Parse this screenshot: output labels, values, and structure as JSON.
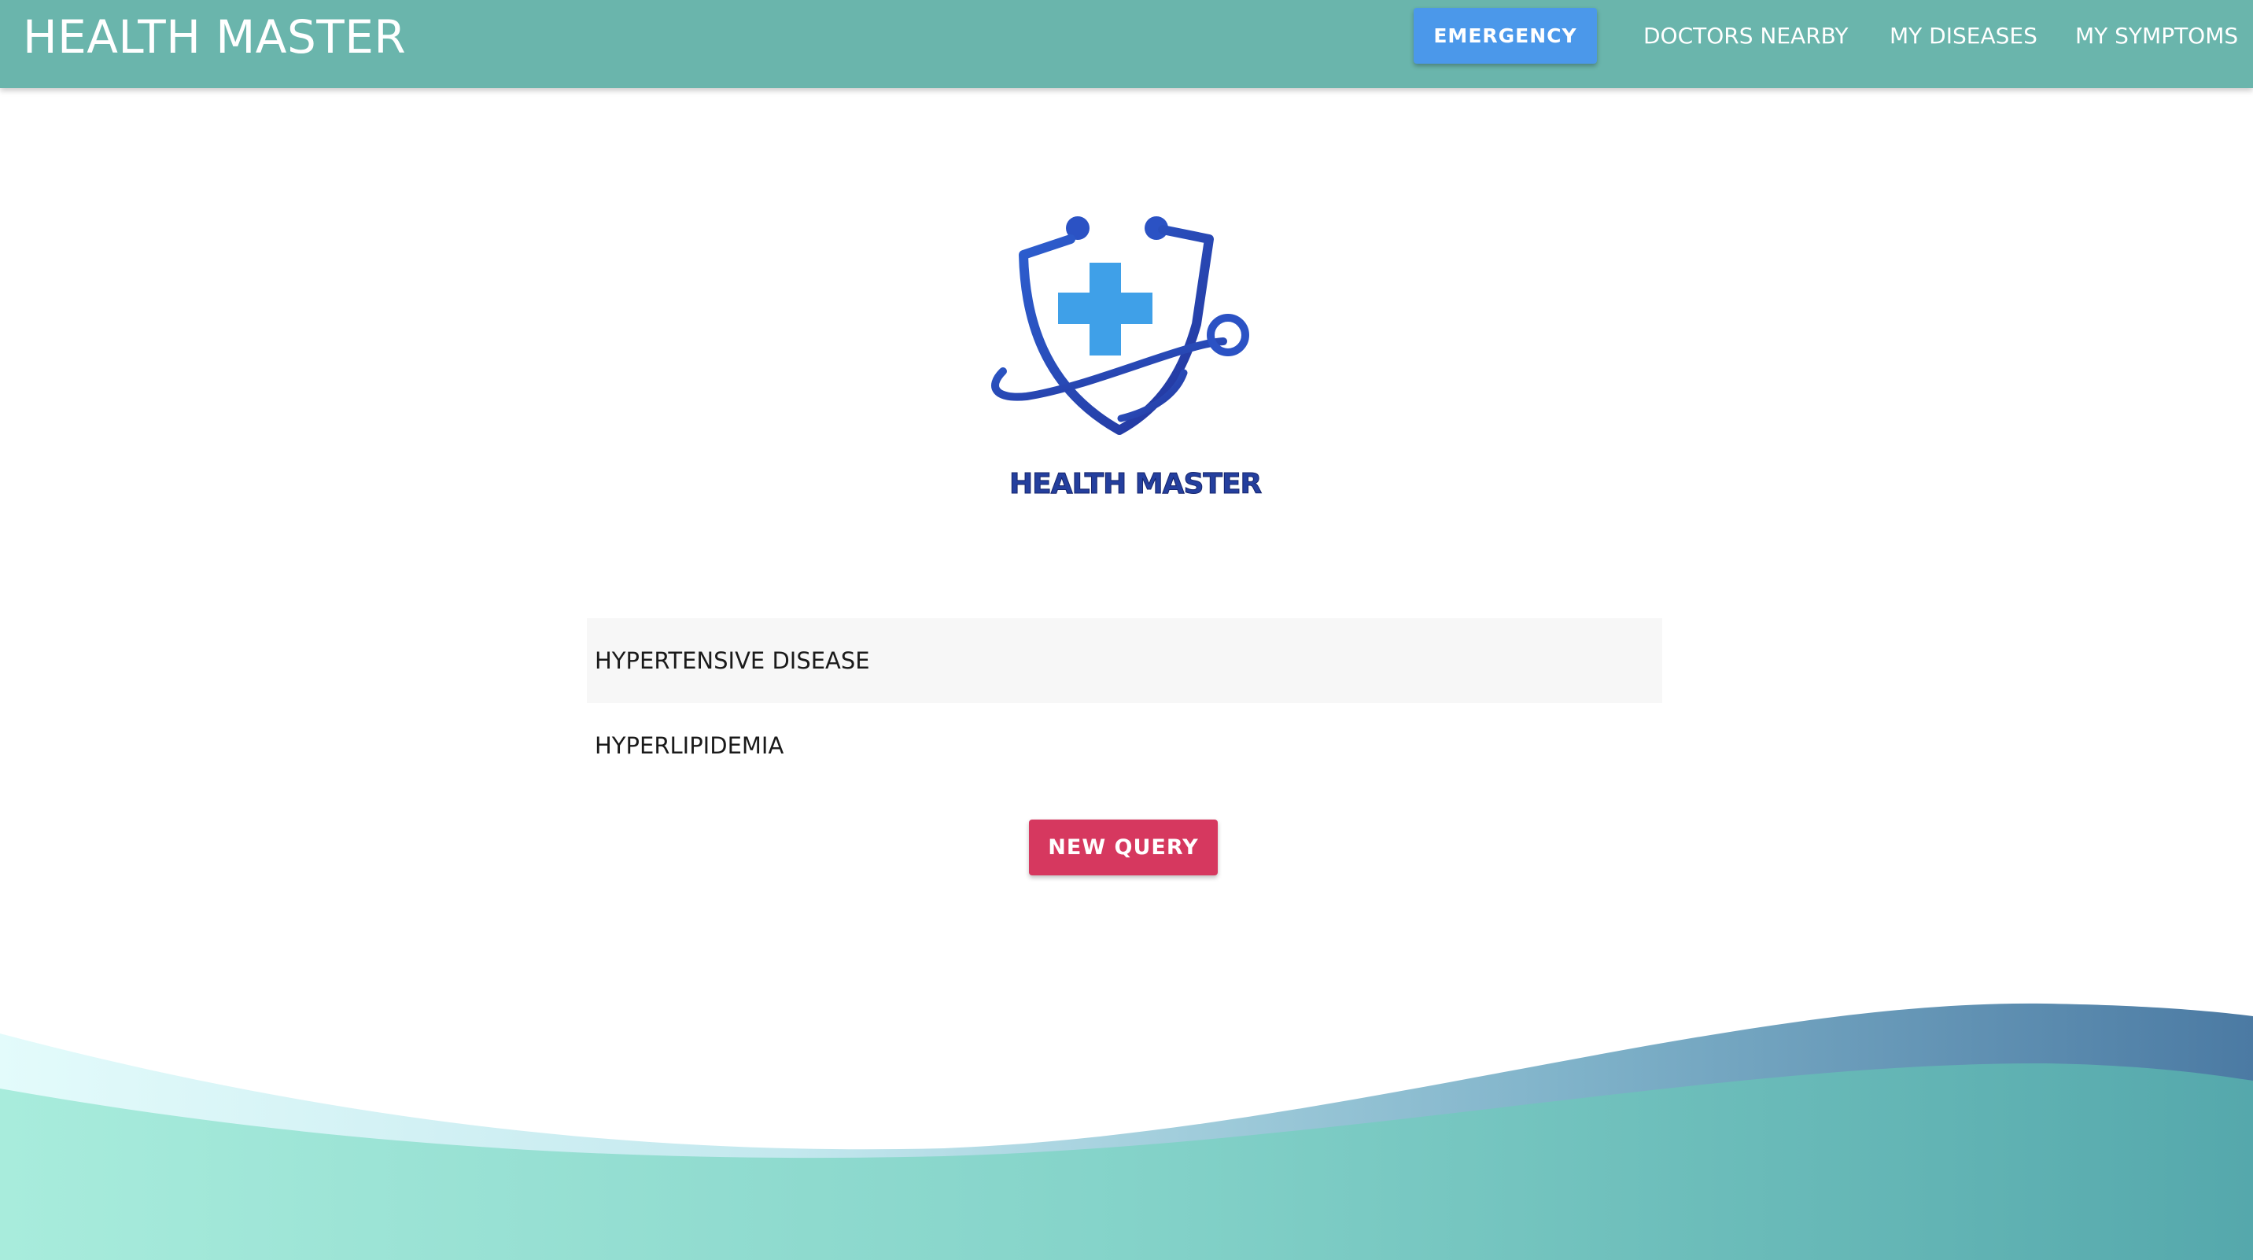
{
  "navbar": {
    "brand": "HEALTH MASTER",
    "emergency_label": "EMERGENCY",
    "links": [
      {
        "label": "DOCTORS NEARBY"
      },
      {
        "label": "MY DISEASES"
      },
      {
        "label": "MY SYMPTOMS"
      }
    ]
  },
  "logo": {
    "text": "HEALTH MASTER",
    "icon": "shield-stethoscope-cross-icon"
  },
  "diseases": [
    {
      "label": "HYPERTENSIVE DISEASE"
    },
    {
      "label": "HYPERLIPIDEMIA"
    }
  ],
  "actions": {
    "new_query_label": "NEW QUERY"
  },
  "colors": {
    "navbar": "#6ab5ac",
    "emergency_button": "#4b98ea",
    "new_query_button": "#d6385f",
    "logo_blue": "#2b52c4",
    "logo_cross": "#3fa0e8",
    "wave_light": "#a6ebdb",
    "wave_dark": "#4f7ea8"
  }
}
